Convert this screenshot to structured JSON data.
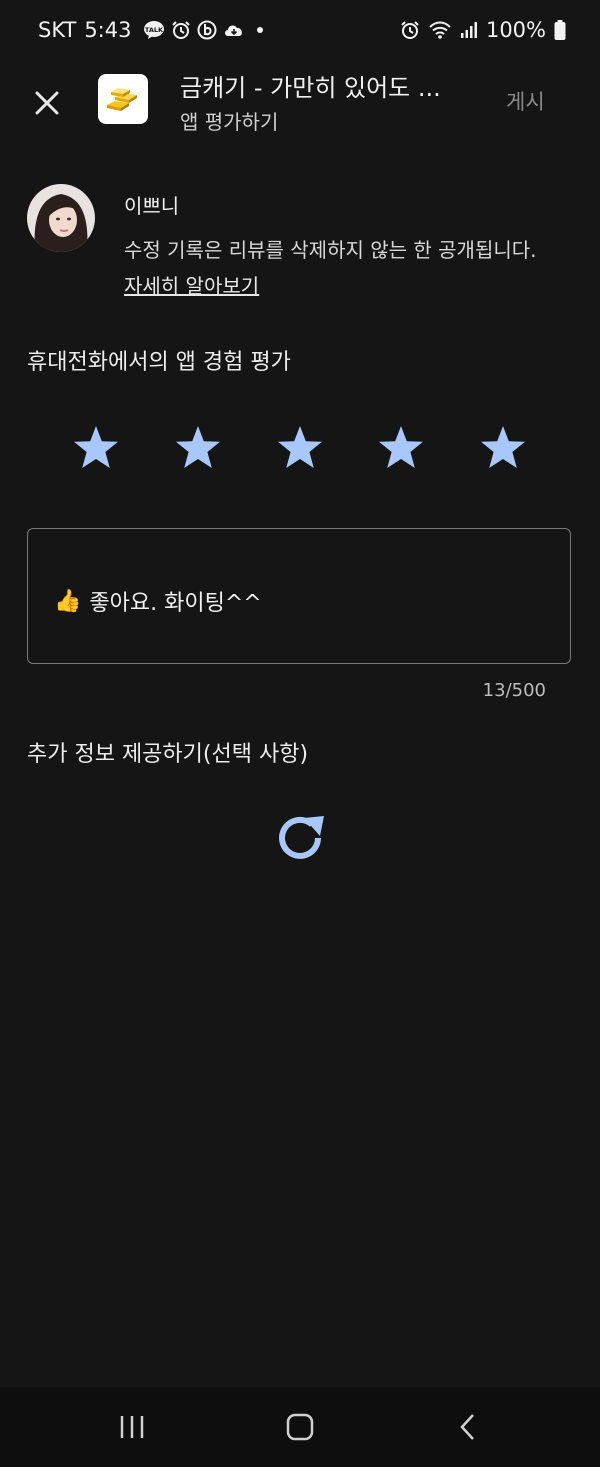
{
  "status_bar": {
    "carrier": "SKT",
    "time": "5:43",
    "battery": "100%",
    "left_icons": [
      "kakaotalk-icon",
      "alarm-icon",
      "b-app-icon",
      "cloud-sync-icon"
    ],
    "right_icons": [
      "alarm-icon",
      "wifi-icon",
      "signal-icon",
      "battery-icon"
    ]
  },
  "header": {
    "app_title": "금캐기 - 가만히 있어도 ...",
    "subtitle": "앱 평가하기",
    "post_label": "게시"
  },
  "profile": {
    "username": "이쁘니",
    "notice": "수정 기록은 리뷰를 삭제하지 않는 한 공개됩니다. ",
    "learn_more": "자세히 알아보기"
  },
  "rating": {
    "title": "휴대전화에서의 앱 경험 평가",
    "stars_filled": 5,
    "stars_total": 5,
    "star_color": "#a8c7fa"
  },
  "review": {
    "emoji": "👍",
    "text": "좋아요. 화이팅^^",
    "counter": "13/500"
  },
  "extra": {
    "title": "추가 정보 제공하기(선택 사항)"
  },
  "colors": {
    "background": "#151515",
    "accent": "#a8c7fa"
  }
}
